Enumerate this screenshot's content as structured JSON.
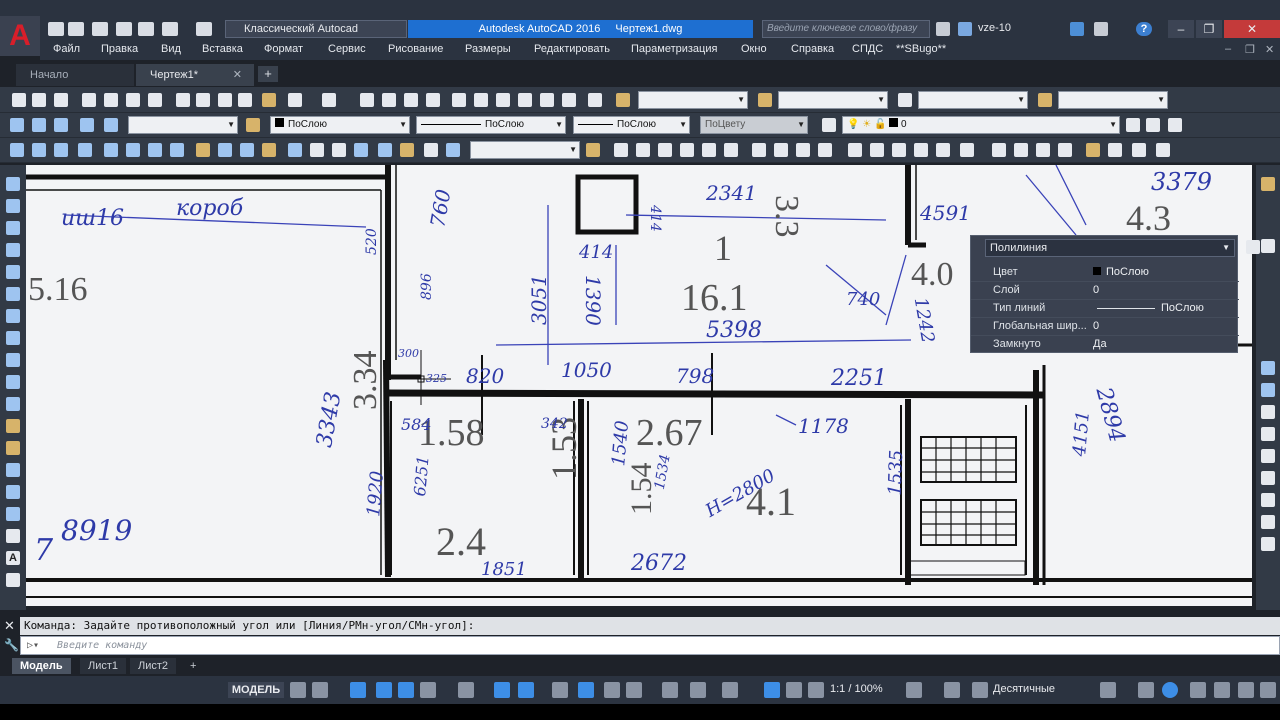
{
  "title_bar": {
    "workspace": "Классический Autocad",
    "app_name": "Autodesk AutoCAD 2016",
    "file_name": "Чертеж1.dwg",
    "search_placeholder": "Введите ключевое слово/фразу",
    "user": "vze-10",
    "help": "?"
  },
  "menu": [
    "Файл",
    "Правка",
    "Вид",
    "Вставка",
    "Формат",
    "Сервис",
    "Рисование",
    "Размеры",
    "Редактировать",
    "Параметризация",
    "Окно",
    "Справка",
    "СПДС",
    "**SBugo**"
  ],
  "tabs": {
    "start": "Начало",
    "drawing": "Чертеж1*",
    "close_glyph": "✕",
    "add_glyph": "+"
  },
  "toolbar": {
    "color_combo": "ПоСлою",
    "linetype_combo": "ПоСлою",
    "lineweight_combo": "ПоСлою",
    "plotstyle_combo": "ПоЦвету",
    "layer_combo": "0"
  },
  "properties_panel": {
    "object_type": "Полилиния",
    "rows": [
      {
        "name": "Цвет",
        "value": "ПоСлою"
      },
      {
        "name": "Слой",
        "value": "0"
      },
      {
        "name": "Тип линий",
        "value": "ПоСлою"
      },
      {
        "name": "Глобальная шир...",
        "value": "0"
      },
      {
        "name": "Замкнуто",
        "value": "Да"
      }
    ]
  },
  "drawing_text": {
    "room_labels": [
      "5.16",
      "3.34",
      "16.1",
      "1",
      "1.58",
      "1.53",
      "2.67",
      "4.1",
      "2.4",
      "3.3",
      "4.3",
      "4.0",
      "1.54"
    ],
    "handwriting": [
      "иш16",
      "короб",
      "760",
      "2341",
      "3379",
      "414",
      "414",
      "3051",
      "1390",
      "5398",
      "740",
      "4591",
      "1242",
      "2894",
      "300",
      "325",
      "820",
      "1050",
      "798",
      "2251",
      "3343",
      "584",
      "342",
      "1178",
      "6251",
      "1540",
      "1534",
      "1535",
      "4151",
      "1920",
      "8919",
      "7",
      "1851",
      "2672",
      "H=2800",
      "520",
      "896"
    ]
  },
  "command_line": {
    "history": "Команда: Задайте противоположный угол или [Линия/РМн-угол/СМн-угол]:",
    "prompt_placeholder": "Введите команду"
  },
  "layout_tabs": [
    "Модель",
    "Лист1",
    "Лист2",
    "+"
  ],
  "status_bar": {
    "space": "МОДЕЛЬ",
    "annotation_scale": "1:1 / 100%",
    "units": "Десятичные"
  },
  "colors": {
    "accent": "#1e6fd1",
    "logo": "#d81e2a",
    "background": "#1e2229"
  }
}
